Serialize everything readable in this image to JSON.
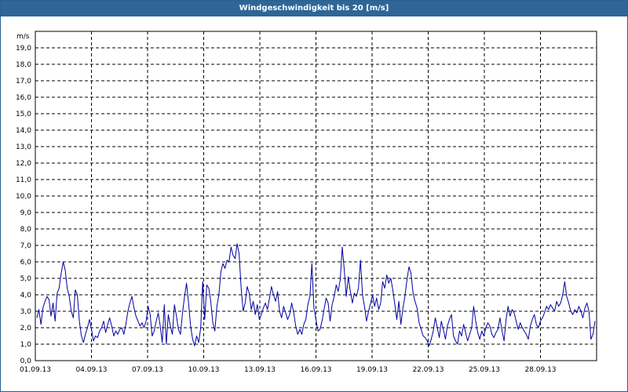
{
  "window": {
    "title": "Windgeschwindigkeit bis 20 [m/s]"
  },
  "colors": {
    "series": "#0000a0",
    "grid": "#000000",
    "title_bar": "#2e6698"
  },
  "chart_data": {
    "type": "line",
    "title": "Windgeschwindigkeit bis 20 [m/s]",
    "ylabel": "m/s",
    "ylim": [
      0,
      20
    ],
    "xlim": [
      "01.09.13",
      "01.10.13"
    ],
    "grid": true,
    "legend": "none",
    "y_ticks": [
      "1,0",
      "2,0",
      "3,0",
      "4,0",
      "5,0",
      "6,0",
      "7,0",
      "8,0",
      "9,0",
      "10,0",
      "11,0",
      "12,0",
      "13,0",
      "14,0",
      "15,0",
      "16,0",
      "17,0",
      "18,0",
      "19,0"
    ],
    "x_ticks": [
      "01.09.13",
      "04.09.13",
      "07.09.13",
      "10.09.13",
      "13.09.13",
      "16.09.13",
      "19.09.13",
      "22.09.13",
      "25.09.13",
      "28.09.13"
    ],
    "series": [
      {
        "values": [
          2.6,
          3.1,
          2.2,
          3.2,
          3.6,
          3.9,
          3.7,
          2.7,
          3.5,
          2.4,
          4.1,
          4.4,
          5.3,
          6.0,
          5.5,
          4.4,
          3.9,
          3.0,
          2.6,
          4.3,
          4.0,
          2.4,
          1.5,
          1.1,
          1.6,
          2.0,
          2.5,
          1.9,
          1.2,
          1.5,
          1.4,
          1.8,
          2.0,
          2.4,
          1.7,
          2.2,
          2.6,
          2.1,
          1.5,
          1.8,
          1.6,
          1.9,
          2.0,
          1.6,
          2.2,
          3.0,
          3.5,
          3.9,
          3.2,
          2.7,
          2.4,
          2.1,
          2.3,
          2.0,
          2.4,
          3.3,
          2.8,
          1.5,
          1.8,
          2.4,
          2.9,
          2.1,
          1.1,
          3.4,
          1.0,
          2.8,
          2.1,
          1.6,
          3.4,
          2.7,
          1.9,
          1.6,
          2.9,
          3.9,
          4.7,
          3.5,
          2.1,
          1.3,
          0.9,
          1.5,
          1.1,
          2.0,
          4.8,
          2.5,
          4.6,
          4.4,
          3.6,
          2.3,
          1.8,
          3.3,
          4.0,
          5.4,
          5.9,
          5.6,
          6.1,
          6.0,
          6.9,
          6.4,
          6.2,
          7.1,
          6.5,
          4.4,
          3.0,
          3.5,
          4.5,
          4.1,
          3.1,
          3.6,
          2.8,
          3.4,
          2.5,
          2.8,
          3.2,
          3.5,
          3.1,
          3.8,
          4.5,
          4.0,
          3.6,
          4.2,
          3.0,
          2.6,
          3.3,
          2.9,
          2.5,
          2.8,
          3.5,
          2.9,
          2.1,
          1.6,
          1.9,
          1.6,
          2.2,
          2.5,
          3.4,
          3.9,
          5.9,
          3.2,
          2.5,
          1.8,
          1.9,
          2.4,
          3.1,
          3.8,
          3.5,
          2.4,
          3.4,
          3.9,
          4.6,
          4.2,
          4.9,
          6.9,
          5.5,
          3.9,
          5.1,
          4.2,
          3.5,
          4.1,
          3.9,
          4.4,
          6.1,
          4.0,
          3.3,
          2.4,
          3.0,
          3.5,
          4.0,
          3.3,
          3.8,
          3.1,
          3.5,
          4.8,
          4.4,
          5.2,
          4.7,
          5.0,
          4.3,
          3.4,
          2.5,
          3.6,
          2.2,
          3.2,
          3.9,
          4.9,
          5.7,
          5.3,
          4.1,
          3.6,
          3.2,
          2.3,
          1.9,
          1.5,
          1.4,
          1.2,
          0.9,
          1.3,
          1.8,
          2.6,
          2.0,
          1.4,
          2.4,
          1.9,
          1.3,
          2.1,
          2.5,
          2.8,
          1.5,
          1.2,
          1.0,
          1.8,
          1.5,
          2.2,
          1.7,
          1.2,
          1.6,
          2.0,
          3.3,
          2.4,
          1.7,
          1.3,
          1.8,
          1.5,
          2.0,
          2.3,
          2.1,
          1.6,
          1.4,
          1.7,
          1.9,
          2.6,
          1.8,
          1.2,
          2.5,
          3.3,
          2.7,
          3.1,
          2.9,
          2.4,
          1.9,
          2.3,
          2.0,
          1.8,
          1.6,
          1.3,
          2.1,
          2.5,
          2.8,
          2.2,
          2.0,
          2.4,
          2.6,
          2.9,
          3.3,
          3.1,
          3.4,
          3.2,
          3.0,
          3.6,
          3.3,
          3.5,
          4.0,
          4.8,
          3.9,
          3.5,
          3.0,
          2.8,
          3.1,
          2.9,
          3.3,
          3.0,
          2.6,
          3.2,
          3.5,
          3.0,
          1.3,
          1.6,
          2.4
        ]
      }
    ]
  }
}
